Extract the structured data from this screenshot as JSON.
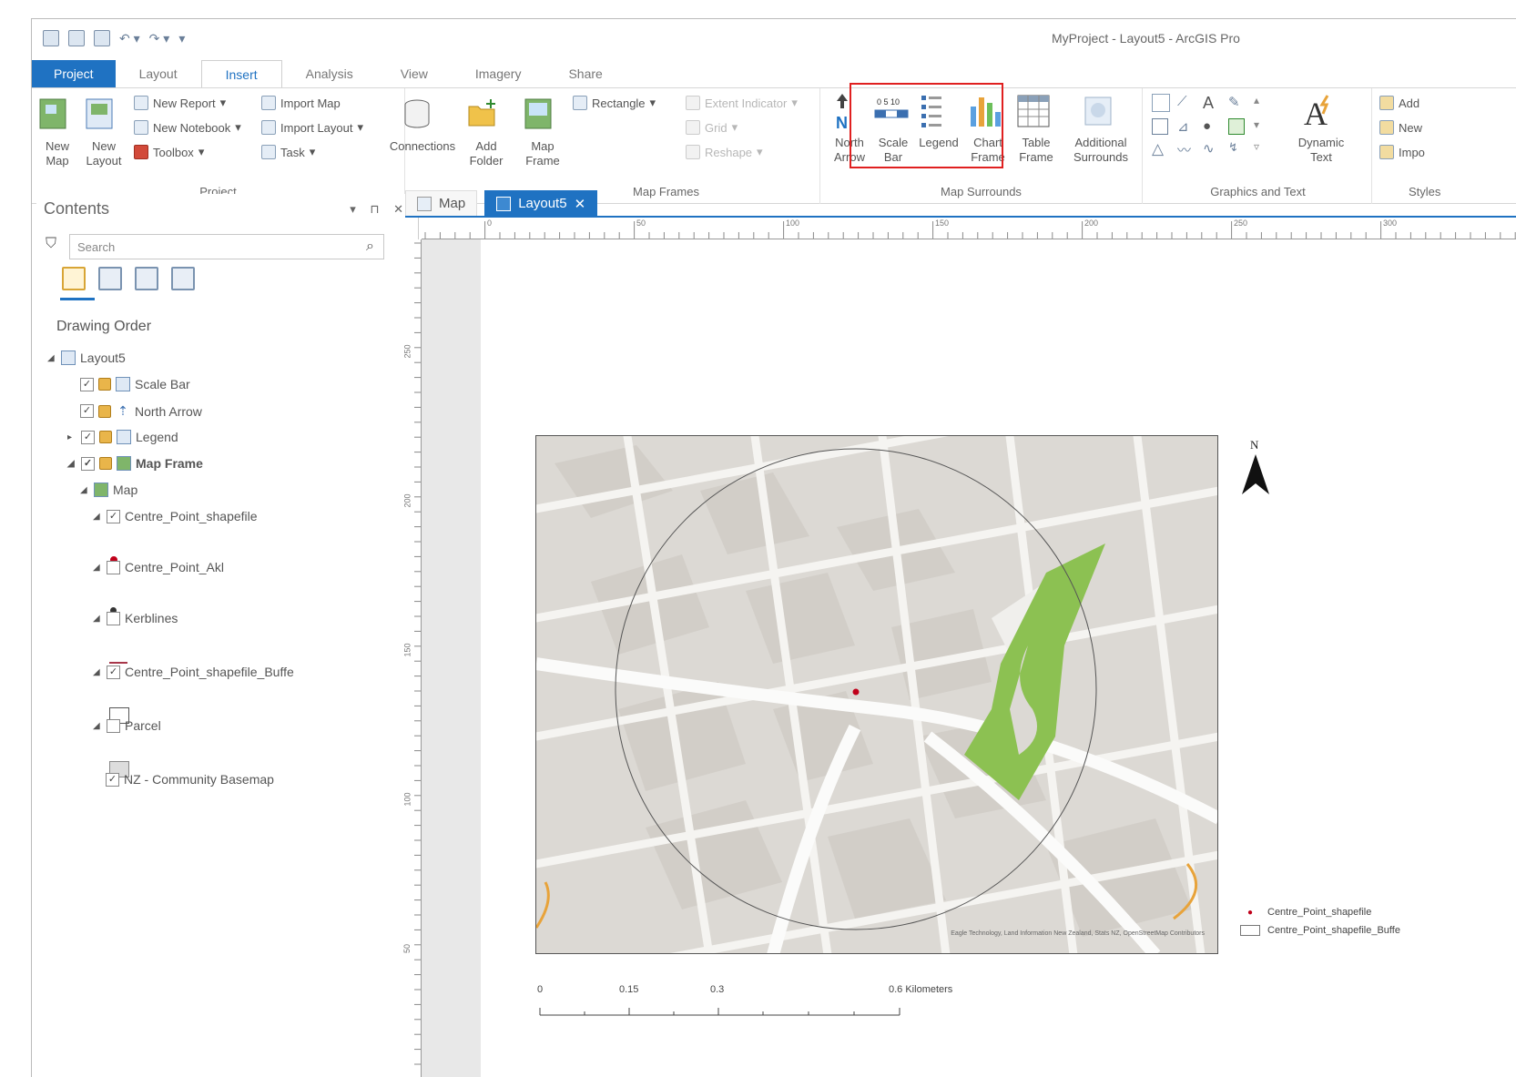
{
  "window": {
    "title": "MyProject - Layout5 - ArcGIS Pro"
  },
  "tabs": [
    "Project",
    "Layout",
    "Insert",
    "Analysis",
    "View",
    "Imagery",
    "Share"
  ],
  "active_tab": "Insert",
  "ribbon": {
    "project": {
      "label": "Project",
      "new_map": "New Map",
      "new_layout": "New Layout",
      "new_report": "New Report",
      "new_notebook": "New Notebook",
      "toolbox": "Toolbox",
      "import_map": "Import Map",
      "import_layout": "Import Layout",
      "task": "Task",
      "connections": "Connections",
      "add_folder": "Add Folder"
    },
    "map_frames": {
      "label": "Map Frames",
      "map_frame": "Map Frame",
      "rectangle": "Rectangle",
      "extent_indicator": "Extent Indicator",
      "grid": "Grid",
      "reshape": "Reshape"
    },
    "map_surrounds": {
      "label": "Map Surrounds",
      "north_arrow": "North Arrow",
      "scale_bar": "Scale Bar",
      "legend": "Legend",
      "chart_frame": "Chart Frame",
      "table_frame": "Table Frame",
      "additional_surrounds": "Additional Surrounds"
    },
    "graphics": {
      "label": "Graphics and Text",
      "dynamic_text": "Dynamic Text"
    },
    "styles": {
      "label": "Styles",
      "add": "Add",
      "new": "New",
      "import": "Impo"
    }
  },
  "contents": {
    "title": "Contents",
    "search_placeholder": "Search",
    "drawing_order": "Drawing Order",
    "layers": [
      {
        "name": "Layout5",
        "checked": null
      },
      {
        "name": "Scale Bar",
        "checked": true
      },
      {
        "name": "North Arrow",
        "checked": true
      },
      {
        "name": "Legend",
        "checked": true
      },
      {
        "name": "Map Frame",
        "checked": true
      },
      {
        "name": "Map",
        "checked": null
      },
      {
        "name": "Centre_Point_shapefile",
        "checked": true
      },
      {
        "name": "Centre_Point_Akl",
        "checked": false
      },
      {
        "name": "Kerblines",
        "checked": false
      },
      {
        "name": "Centre_Point_shapefile_Buffe",
        "checked": true
      },
      {
        "name": "Parcel",
        "checked": false
      },
      {
        "name": "NZ - Community Basemap",
        "checked": true
      }
    ]
  },
  "view_tabs": [
    {
      "label": "Map"
    },
    {
      "label": "Layout5"
    }
  ],
  "ruler": {
    "top": [
      "0",
      "50",
      "100",
      "150",
      "200",
      "250",
      "300"
    ],
    "left": [
      "250",
      "200",
      "150",
      "100",
      "50"
    ]
  },
  "map": {
    "north_label": "N",
    "attribution": "Eagle Technology, Land Information New Zealand, Stats NZ, OpenStreetMap Contributors",
    "colors": {
      "park": "#8cc152",
      "point": "#c0001a",
      "road": "#f5f4f1",
      "block": "#d9d6d1"
    }
  },
  "legend": [
    "Centre_Point_shapefile",
    "Centre_Point_shapefile_Buffe"
  ],
  "scalebar": {
    "labels": [
      "0",
      "0.15",
      "0.3",
      "0.6 Kilometers"
    ]
  }
}
